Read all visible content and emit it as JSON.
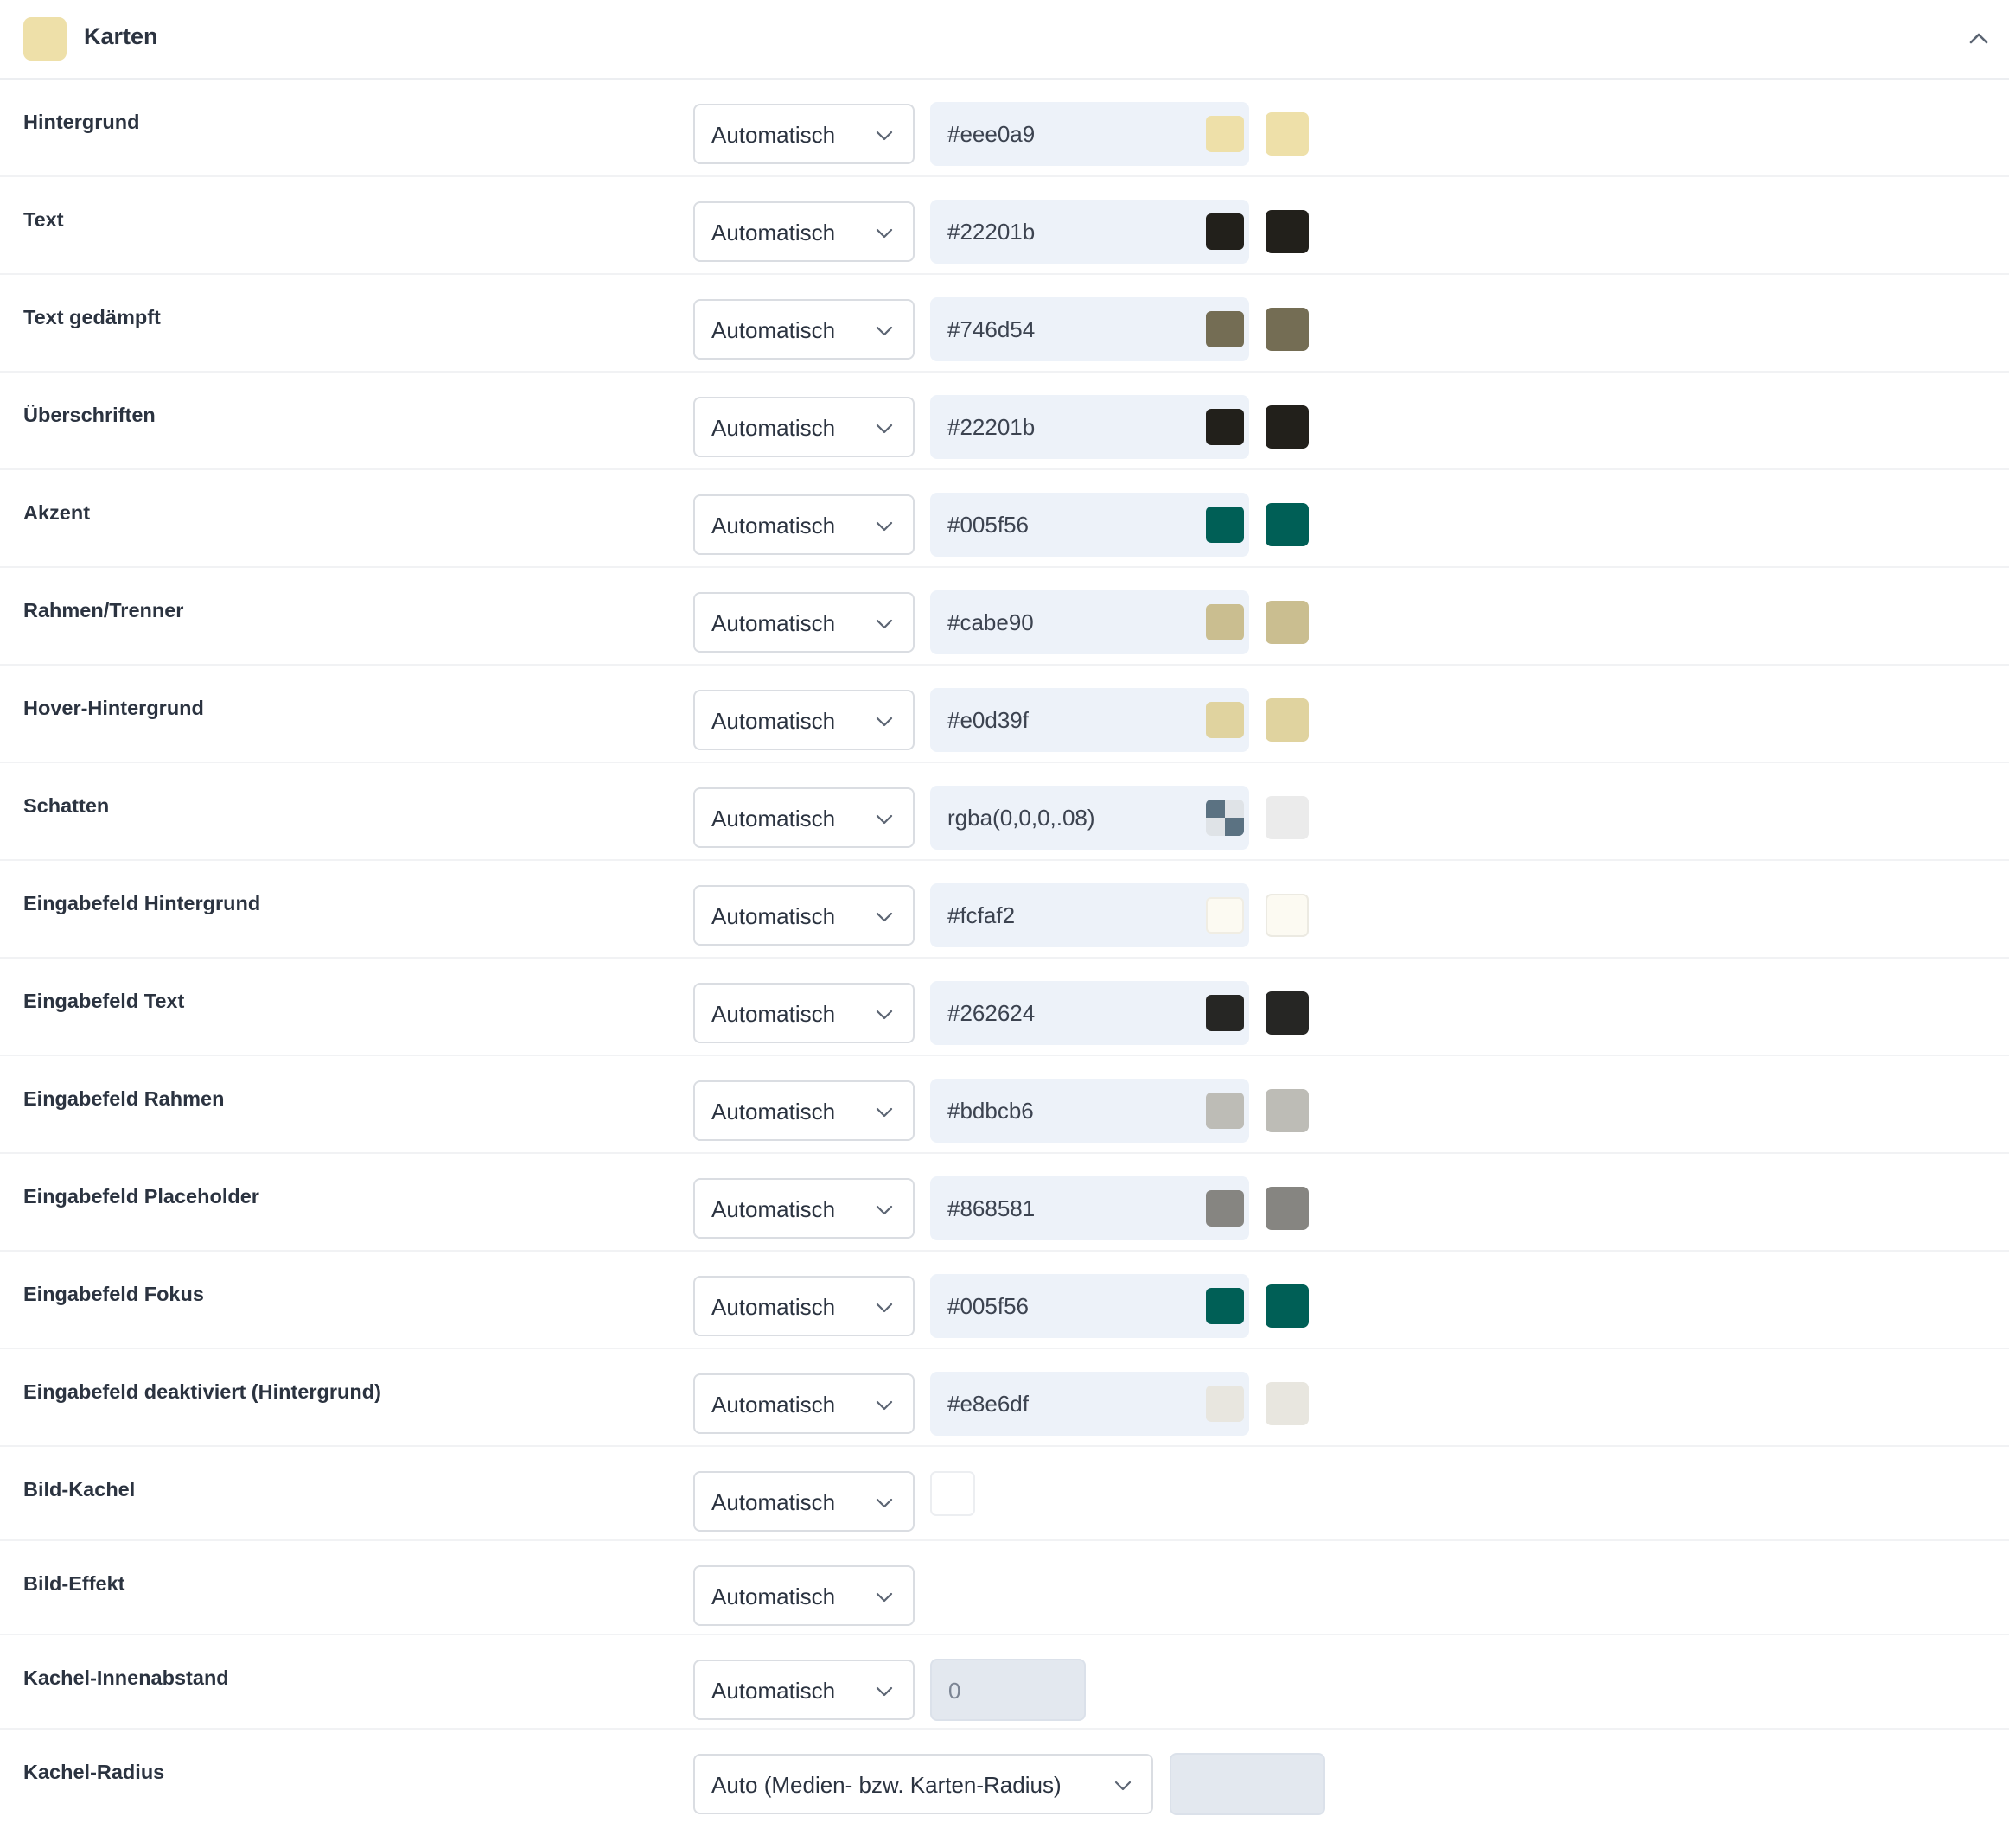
{
  "section": {
    "title": "Karten",
    "swatch_color": "#eee0a9",
    "collapse_icon": "chevron-up-icon"
  },
  "color_rows": [
    {
      "label": "Hintergrund",
      "mode": "Automatisch",
      "value": "#eee0a9",
      "swatch": "#eee0a9"
    },
    {
      "label": "Text",
      "mode": "Automatisch",
      "value": "#22201b",
      "swatch": "#22201b"
    },
    {
      "label": "Text gedämpft",
      "mode": "Automatisch",
      "value": "#746d54",
      "swatch": "#746d54"
    },
    {
      "label": "Überschriften",
      "mode": "Automatisch",
      "value": "#22201b",
      "swatch": "#22201b"
    },
    {
      "label": "Akzent",
      "mode": "Automatisch",
      "value": "#005f56",
      "swatch": "#005f56"
    },
    {
      "label": "Rahmen/Trenner",
      "mode": "Automatisch",
      "value": "#cabe90",
      "swatch": "#cabe90"
    },
    {
      "label": "Hover-Hintergrund",
      "mode": "Automatisch",
      "value": "#e0d39f",
      "swatch": "#e0d39f"
    },
    {
      "label": "Schatten",
      "mode": "Automatisch",
      "value": "rgba(0,0,0,.08)",
      "swatch": "#ebebeb",
      "transparent": true
    },
    {
      "label": "Eingabefeld Hintergrund",
      "mode": "Automatisch",
      "value": "#fcfaf2",
      "swatch": "#fcfaf2"
    },
    {
      "label": "Eingabefeld Text",
      "mode": "Automatisch",
      "value": "#262624",
      "swatch": "#262624"
    },
    {
      "label": "Eingabefeld Rahmen",
      "mode": "Automatisch",
      "value": "#bdbcb6",
      "swatch": "#bdbcb6"
    },
    {
      "label": "Eingabefeld Placeholder",
      "mode": "Automatisch",
      "value": "#868581",
      "swatch": "#868581"
    },
    {
      "label": "Eingabefeld Fokus",
      "mode": "Automatisch",
      "value": "#005f56",
      "swatch": "#005f56"
    },
    {
      "label": "Eingabefeld deaktiviert (Hintergrund)",
      "mode": "Automatisch",
      "value": "#e8e6df",
      "swatch": "#e8e6df"
    }
  ],
  "bild_kachel": {
    "label": "Bild-Kachel",
    "mode": "Automatisch"
  },
  "bild_effekt": {
    "label": "Bild-Effekt",
    "mode": "Automatisch"
  },
  "kachel_innenabstand": {
    "label": "Kachel-Innenabstand",
    "mode": "Automatisch",
    "value": "0"
  },
  "kachel_radius": {
    "label": "Kachel-Radius",
    "mode": "Auto (Medien- bzw. Karten-Radius)",
    "value": ""
  }
}
